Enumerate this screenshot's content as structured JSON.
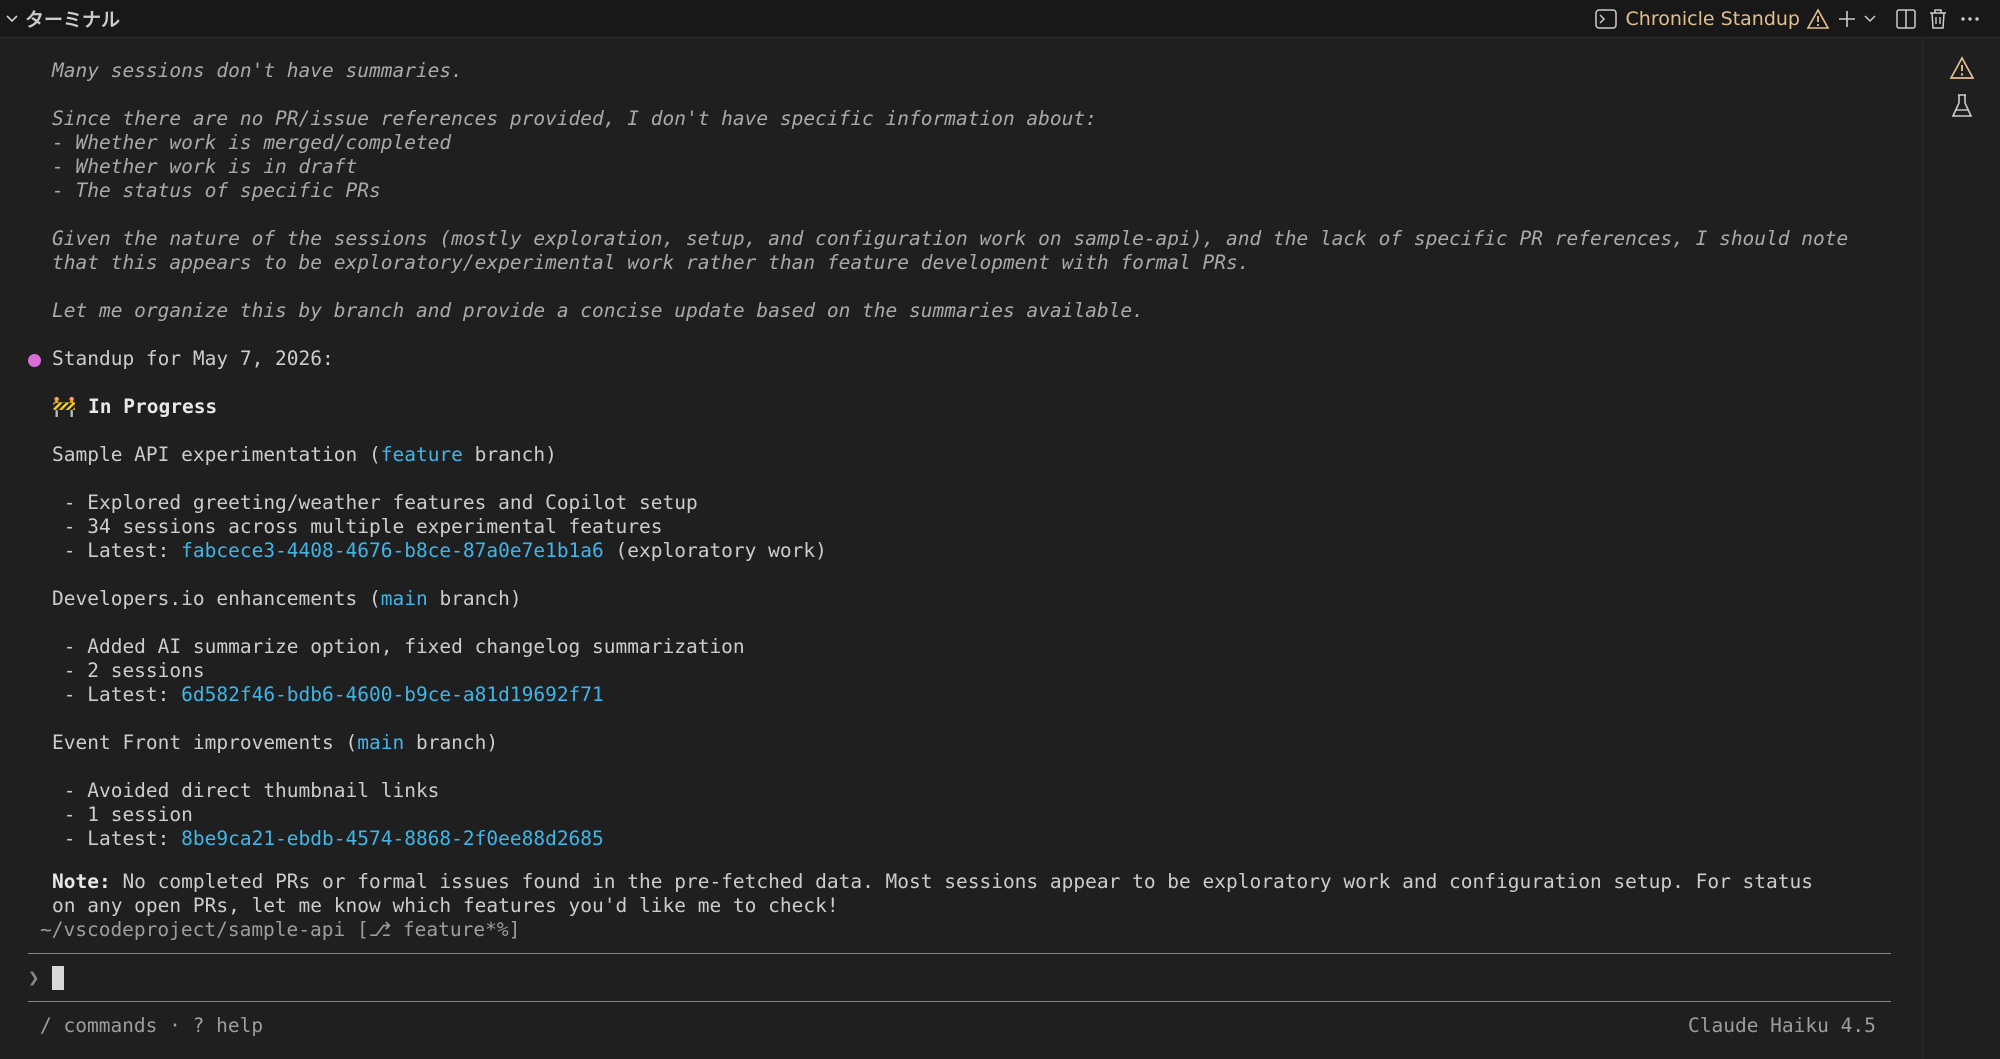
{
  "header": {
    "panel_title": "ターミナル",
    "terminal_name": "Chronicle Standup",
    "icons": [
      "chevron-down-icon",
      "terminal-icon",
      "warning-icon",
      "plus-icon",
      "chevron-down-icon",
      "split-icon",
      "trash-icon",
      "more-icon"
    ]
  },
  "colors": {
    "link": "#3fb6e8",
    "warning": "#e2c08d",
    "dot": "#d670d6",
    "background": "#1f1f1f"
  },
  "thinking": {
    "l1": "Many sessions don't have summaries.",
    "l2": "Since there are no PR/issue references provided, I don't have specific information about:",
    "l3": "- Whether work is merged/completed",
    "l4": "- Whether work is in draft",
    "l5": "- The status of specific PRs",
    "l6": "Given the nature of the sessions (mostly exploration, setup, and configuration work on sample-api), and the lack of specific PR references, I should note",
    "l7": "that this appears to be exploratory/experimental work rather than feature development with formal PRs.",
    "l8": "Let me organize this by branch and provide a concise update based on the summaries available."
  },
  "response": {
    "standup_heading": "Standup for May 7, 2026:",
    "section_emoji": "🚧",
    "section_title": "In Progress",
    "groups": [
      {
        "title_pre": "Sample API experimentation (",
        "branch": "feature",
        "title_post": " branch)",
        "bullet1": " - Explored greeting/weather features and Copilot setup",
        "bullet2": " - 34 sessions across multiple experimental features",
        "latest_label": " - Latest: ",
        "latest_id": "fabcece3-4408-4676-b8ce-87a0e7e1b1a6",
        "latest_suffix": " (exploratory work)"
      },
      {
        "title_pre": "Developers.io enhancements (",
        "branch": "main",
        "title_post": " branch)",
        "bullet1": " - Added AI summarize option, fixed changelog summarization",
        "bullet2": " - 2 sessions",
        "latest_label": " - Latest: ",
        "latest_id": "6d582f46-bdb6-4600-b9ce-a81d19692f71",
        "latest_suffix": ""
      },
      {
        "title_pre": "Event Front improvements (",
        "branch": "main",
        "title_post": " branch)",
        "bullet1": " - Avoided direct thumbnail links",
        "bullet2": " - 1 session",
        "latest_label": " - Latest: ",
        "latest_id": "8be9ca21-ebdb-4574-8868-2f0ee88d2685",
        "latest_suffix": ""
      }
    ],
    "note_label": "Note:",
    "note_line1": " No completed PRs or formal issues found in the pre-fetched data. Most sessions appear to be exploratory work and configuration setup. For status",
    "note_line2": "on any open PRs, let me know which features you'd like me to check!"
  },
  "status": {
    "cwd": "~/vscodeproject/sample-api [⎇ feature*%]",
    "prompt_char": "❯",
    "commands_hint": "/ commands · ? help",
    "model": "Claude Haiku 4.5"
  }
}
